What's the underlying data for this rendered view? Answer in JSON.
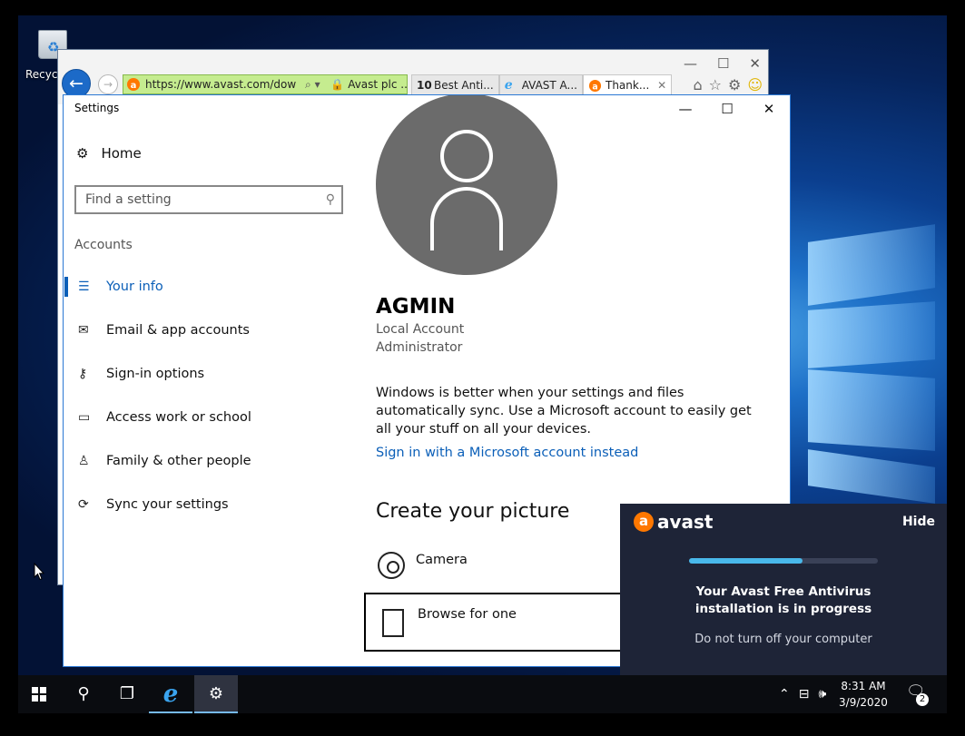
{
  "desktop": {
    "recycle_label": "Recycl"
  },
  "ie": {
    "url": "https://www.avast.com/dow",
    "cert_label": "Avast plc ...",
    "tabs": [
      {
        "label": "Best Anti..."
      },
      {
        "label": "AVAST A..."
      },
      {
        "label": "Thank..."
      }
    ]
  },
  "settings": {
    "title": "Settings",
    "home_label": "Home",
    "search_placeholder": "Find a setting",
    "section": "Accounts",
    "nav": [
      {
        "label": "Your info",
        "icon": "your-info-icon",
        "selected": true
      },
      {
        "label": "Email & app accounts",
        "icon": "mail-icon"
      },
      {
        "label": "Sign-in options",
        "icon": "key-icon"
      },
      {
        "label": "Access work or school",
        "icon": "briefcase-icon"
      },
      {
        "label": "Family & other people",
        "icon": "person-add-icon"
      },
      {
        "label": "Sync your settings",
        "icon": "sync-icon"
      }
    ],
    "user": {
      "name": "AGMIN",
      "account_type": "Local Account",
      "role": "Administrator"
    },
    "description": "Windows is better when your settings and files automatically sync. Use a Microsoft account to easily get all your stuff on all your devices.",
    "ms_link": "Sign in with a Microsoft account instead",
    "picture_heading": "Create your picture",
    "camera_label": "Camera",
    "browse_label": "Browse for one"
  },
  "avast": {
    "brand": "avast",
    "hide_label": "Hide",
    "progress": 0.6,
    "message": "Your Avast Free Antivirus installation is in progress",
    "sub": "Do not turn off your computer"
  },
  "taskbar": {
    "time": "8:31 AM",
    "date": "3/9/2020",
    "notification_count": "2"
  }
}
